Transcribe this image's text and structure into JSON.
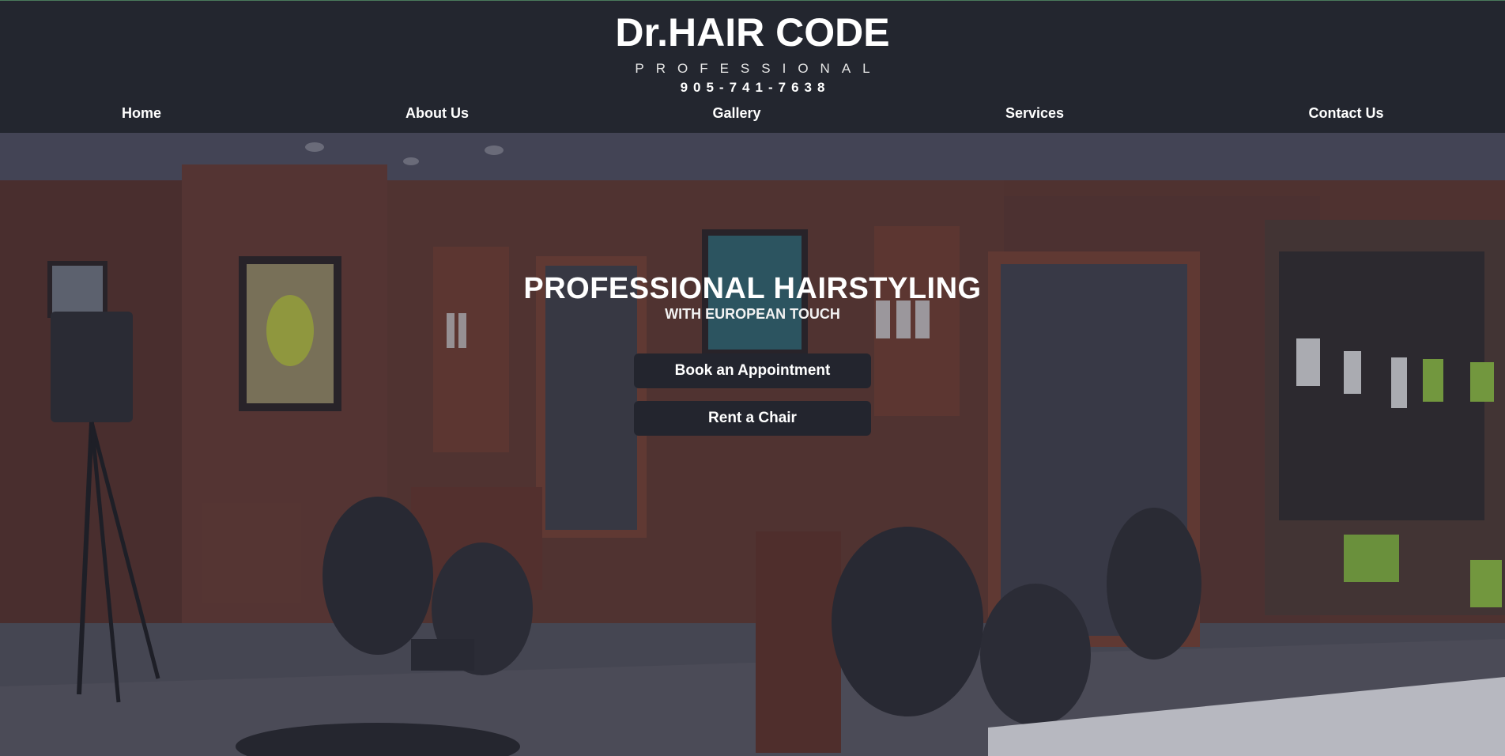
{
  "brand": {
    "name": "Dr.HAIR CODE",
    "tagline": "PROFESSIONAL",
    "phone": "905-741-7638"
  },
  "nav": {
    "items": [
      {
        "label": "Home"
      },
      {
        "label": "About Us"
      },
      {
        "label": "Gallery"
      },
      {
        "label": "Services"
      },
      {
        "label": "Contact Us"
      }
    ]
  },
  "hero": {
    "title": "PROFESSIONAL HAIRSTYLING",
    "subtitle": "WITH EUROPEAN TOUCH",
    "buttons": [
      {
        "label": "Book an Appointment"
      },
      {
        "label": "Rent a Chair"
      }
    ]
  },
  "colors": {
    "header_bg": "#23262f",
    "button_bg": "#23252e",
    "text": "#ffffff",
    "wall": "#5a352f"
  }
}
